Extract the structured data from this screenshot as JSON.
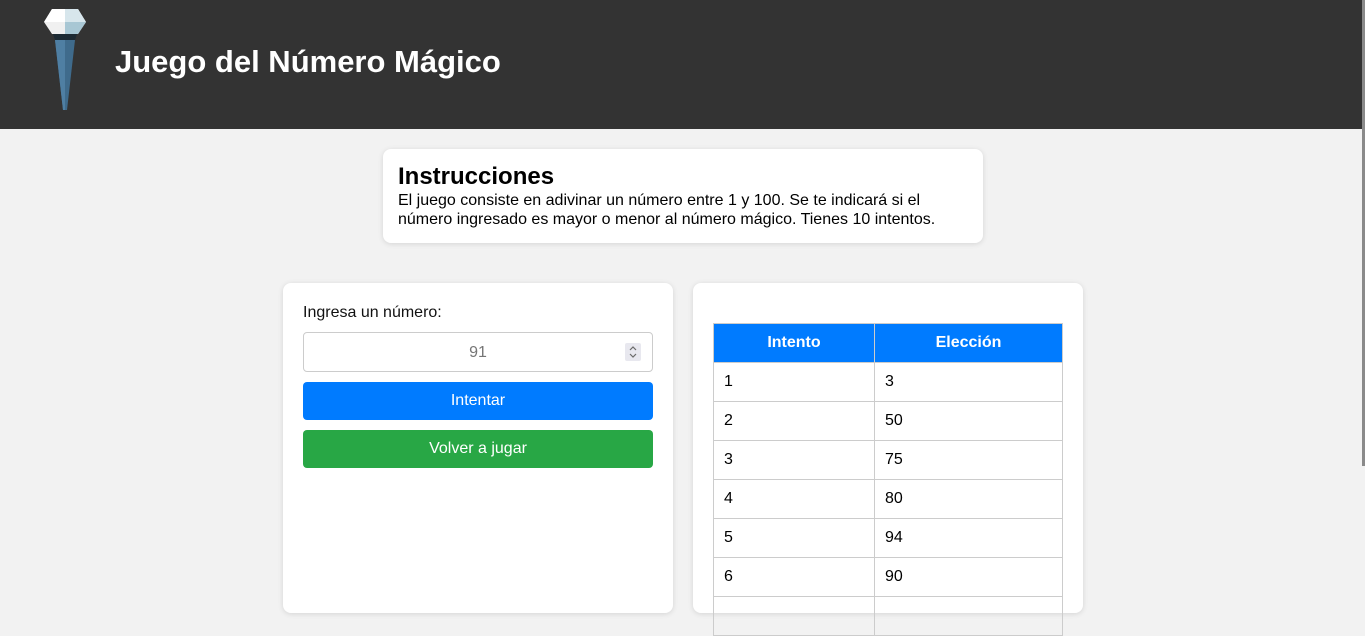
{
  "header": {
    "title": "Juego del Número Mágico",
    "logo_icon": "torch-icon"
  },
  "instructions": {
    "heading": "Instrucciones",
    "text": "El juego consiste en adivinar un número entre 1 y 100. Se te indicará si el número ingresado es mayor o menor al número mágico. Tienes 10 intentos."
  },
  "form": {
    "label": "Ingresa un número:",
    "input_value": "91",
    "try_button": "Intentar",
    "replay_button": "Volver a jugar"
  },
  "history": {
    "headers": [
      "Intento",
      "Elección"
    ],
    "rows": [
      [
        "1",
        "3"
      ],
      [
        "2",
        "50"
      ],
      [
        "3",
        "75"
      ],
      [
        "4",
        "80"
      ],
      [
        "5",
        "94"
      ],
      [
        "6",
        "90"
      ]
    ]
  },
  "colors": {
    "header_bg": "#333333",
    "primary": "#007bff",
    "success": "#28a745",
    "page_bg": "#f2f2f2"
  }
}
